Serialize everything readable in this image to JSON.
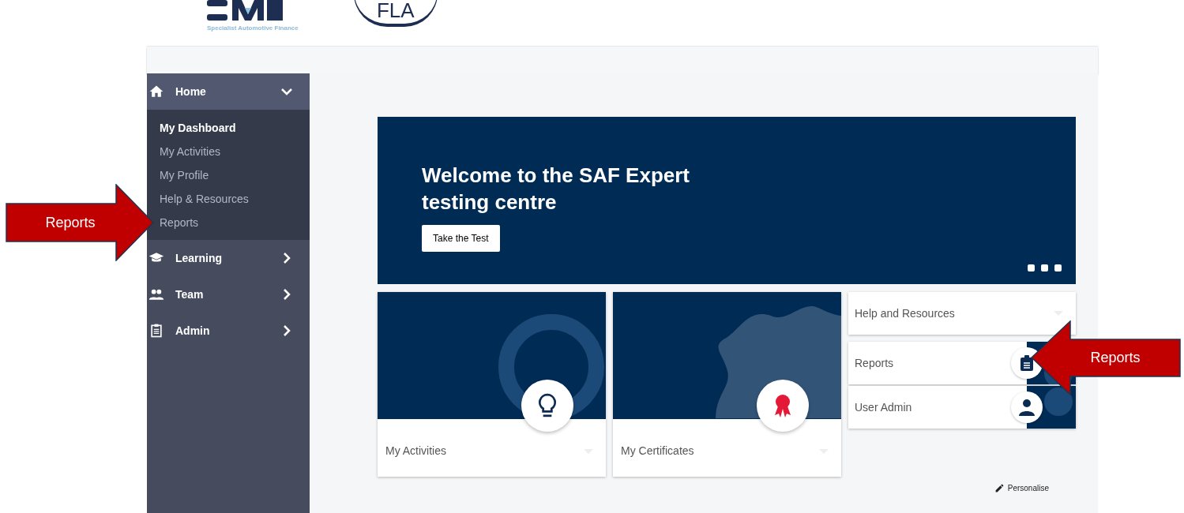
{
  "header": {
    "logo_tagline": "Specialist Automotive Finance",
    "partner_logo": "FLA"
  },
  "sidebar": {
    "items": [
      {
        "label": "Home",
        "kind": "home",
        "expanded": true,
        "children": [
          {
            "label": "My Dashboard",
            "selected": true
          },
          {
            "label": "My Activities",
            "selected": false
          },
          {
            "label": "My Profile",
            "selected": false
          },
          {
            "label": "Help & Resources",
            "selected": false
          },
          {
            "label": "Reports",
            "selected": false
          }
        ]
      },
      {
        "label": "Learning",
        "kind": "learning",
        "expanded": false
      },
      {
        "label": "Team",
        "kind": "team",
        "expanded": false
      },
      {
        "label": "Admin",
        "kind": "admin",
        "expanded": false
      }
    ]
  },
  "hero": {
    "title": "Welcome to the SAF Expert testing centre",
    "button": "Take the Test",
    "slides": [
      {
        "selected": true
      },
      {
        "selected": true
      },
      {
        "selected": true
      }
    ]
  },
  "tiles": [
    {
      "label": "My Activities",
      "kind": "activities"
    },
    {
      "label": "My Certificates",
      "kind": "certificates"
    }
  ],
  "side_tiles": [
    {
      "label": "Help and Resources",
      "kind": "plain"
    },
    {
      "label": "Reports",
      "kind": "reports"
    },
    {
      "label": "User Admin",
      "kind": "user"
    }
  ],
  "personalise": "Personalise",
  "callouts": [
    {
      "label": "Reports"
    },
    {
      "label": "Reports"
    }
  ]
}
